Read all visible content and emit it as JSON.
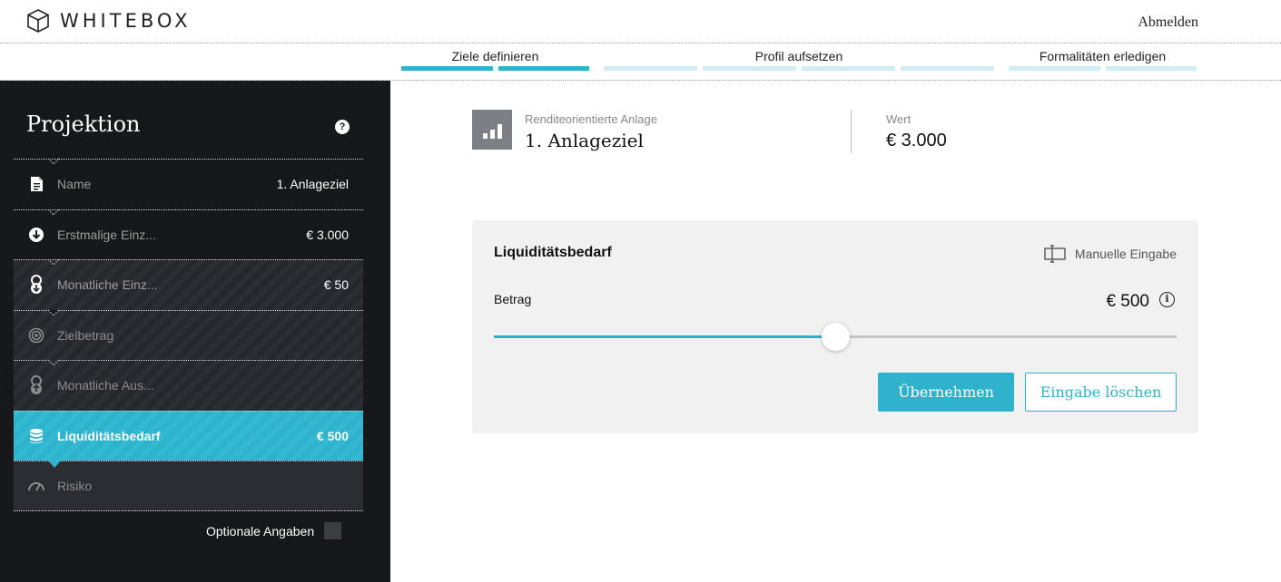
{
  "header": {
    "logo_text": "WHITEBOX",
    "logout_label": "Abmelden"
  },
  "progress": {
    "steps": [
      {
        "label": "Ziele definieren",
        "segments": 2,
        "completed": 2
      },
      {
        "label": "Profil aufsetzen",
        "segments": 4,
        "completed": 0
      },
      {
        "label": "Formalitäten erledigen",
        "segments": 2,
        "completed": 0
      }
    ]
  },
  "sidebar": {
    "title": "Projektion",
    "help_icon": "?",
    "items": [
      {
        "label": "Name",
        "value": "1. Anlageziel",
        "icon": "document-icon",
        "state": "filled"
      },
      {
        "label": "Erstmalige Einz...",
        "value": "€ 3.000",
        "icon": "arrow-down-circle-icon",
        "state": "filled"
      },
      {
        "label": "Monatliche Einz...",
        "value": "€ 50",
        "icon": "recurring-deposit-icon",
        "state": "filled"
      },
      {
        "label": "Zielbetrag",
        "value": "",
        "icon": "target-icon",
        "state": "open"
      },
      {
        "label": "Monatliche Aus...",
        "value": "",
        "icon": "recurring-payout-icon",
        "state": "open"
      },
      {
        "label": "Liquiditätsbedarf",
        "value": "€ 500",
        "icon": "coin-stack-icon",
        "state": "active"
      },
      {
        "label": "Risiko",
        "value": "",
        "icon": "gauge-icon",
        "state": "plain"
      }
    ],
    "optional_label": "Optionale Angaben",
    "optional_checked": false
  },
  "goal": {
    "type_label": "Renditeorientierte Anlage",
    "name": "1. Anlageziel",
    "value_label": "Wert",
    "value": "€ 3.000"
  },
  "card": {
    "title": "Liquiditätsbedarf",
    "manual_label": "Manuelle Eingabe",
    "amount_label": "Betrag",
    "amount_value": "€ 500",
    "info_icon": "i",
    "slider_fraction": 0.5,
    "apply_label": "Übernehmen",
    "clear_label": "Eingabe löschen"
  },
  "colors": {
    "accent": "#2fb3cc",
    "sidebar_bg": "#16181b",
    "card_bg": "#f1f1f1"
  }
}
